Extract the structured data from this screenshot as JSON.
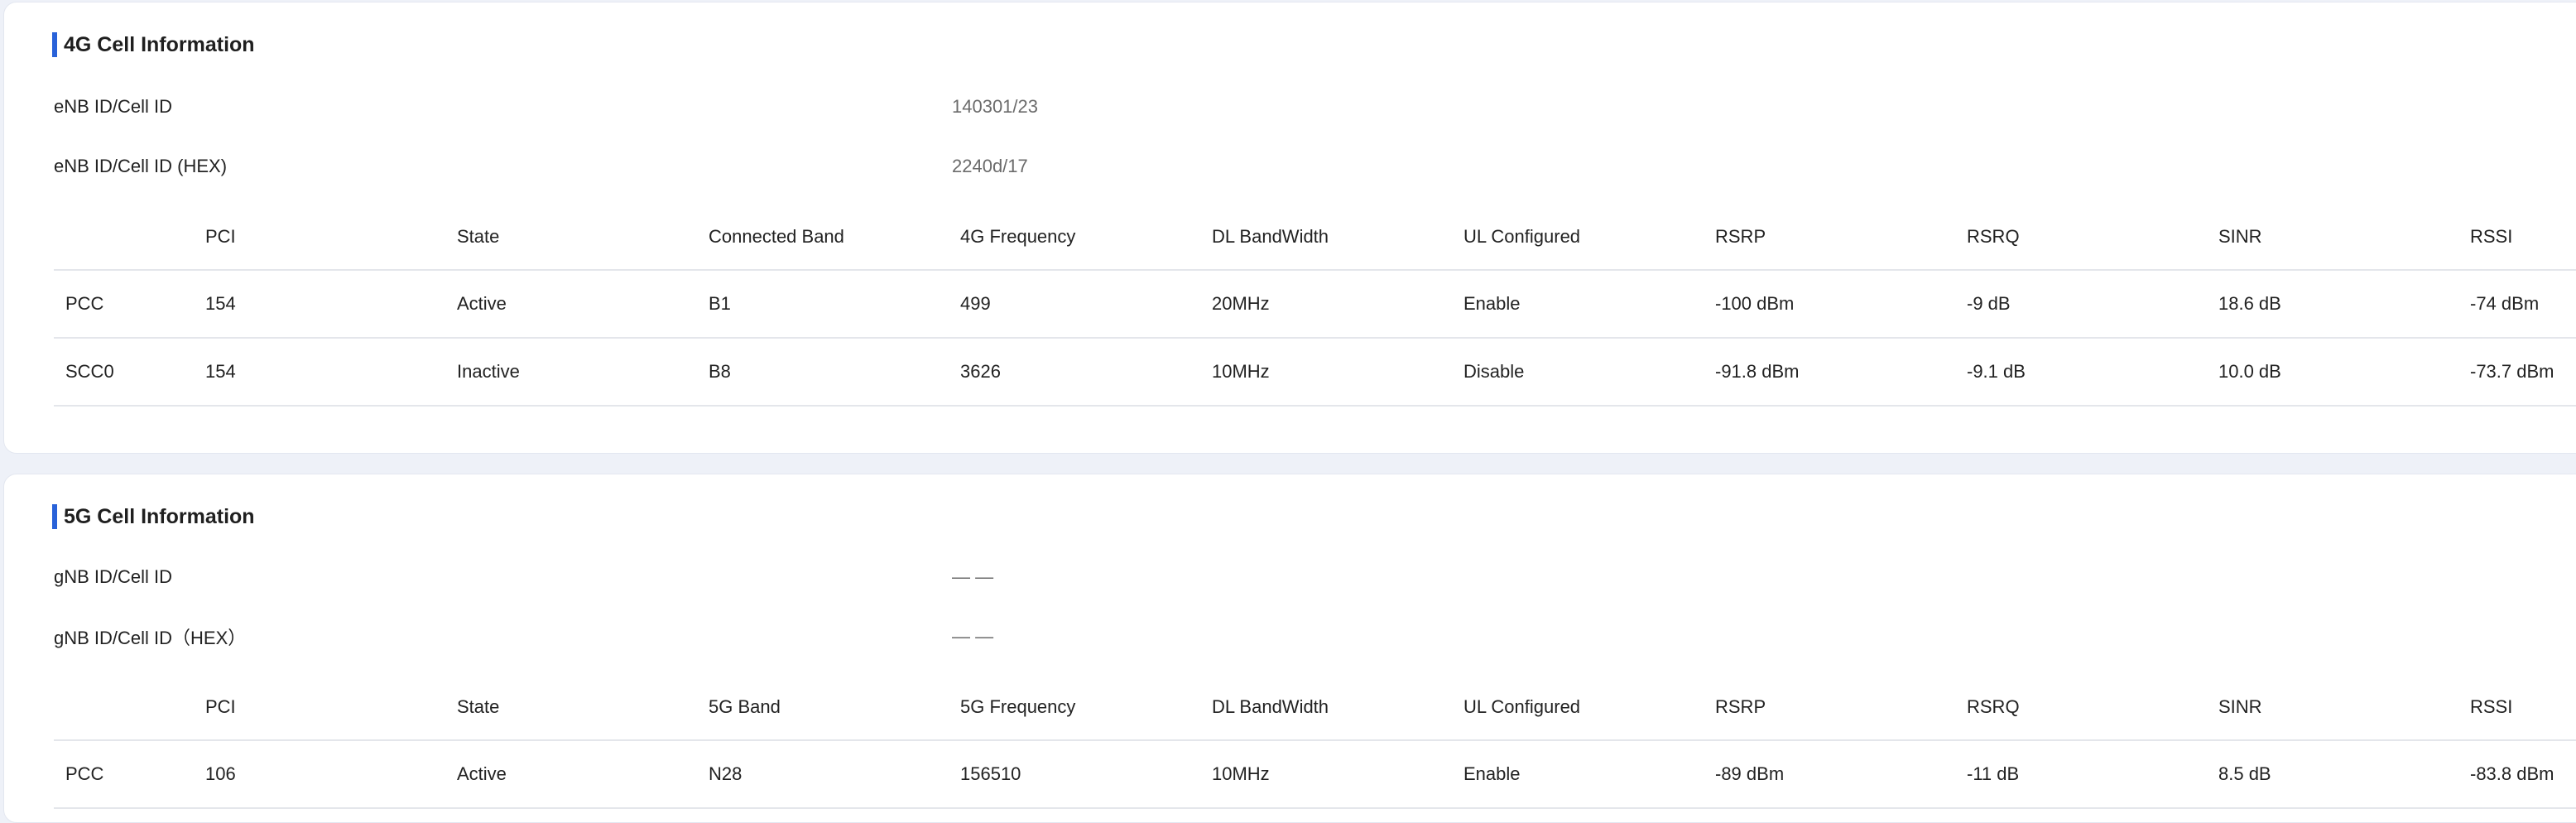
{
  "cell_4g": {
    "title": "4G Cell Information",
    "rows": [
      {
        "label": "eNB ID/Cell ID",
        "value": "140301/23"
      },
      {
        "label": "eNB ID/Cell ID (HEX)",
        "value": "2240d/17"
      }
    ],
    "columns": [
      "",
      "PCI",
      "State",
      "Connected Band",
      "4G Frequency",
      "DL BandWidth",
      "UL Configured",
      "RSRP",
      "RSRQ",
      "SINR",
      "RSSI"
    ],
    "carriers": [
      [
        "PCC",
        "154",
        "Active",
        "B1",
        "499",
        "20MHz",
        "Enable",
        "-100 dBm",
        "-9 dB",
        "18.6 dB",
        "-74 dBm"
      ],
      [
        "SCC0",
        "154",
        "Inactive",
        "B8",
        "3626",
        "10MHz",
        "Disable",
        "-91.8 dBm",
        "-9.1 dB",
        "10.0 dB",
        "-73.7 dBm"
      ]
    ]
  },
  "cell_5g": {
    "title": "5G Cell Information",
    "rows": [
      {
        "label": "gNB ID/Cell ID",
        "value": "— —"
      },
      {
        "label": "gNB ID/Cell ID（HEX）",
        "value": "— —"
      }
    ],
    "columns": [
      "",
      "PCI",
      "State",
      "5G Band",
      "5G Frequency",
      "DL BandWidth",
      "UL Configured",
      "RSRP",
      "RSRQ",
      "SINR",
      "RSSI"
    ],
    "carriers": [
      [
        "PCC",
        "106",
        "Active",
        "N28",
        "156510",
        "10MHz",
        "Enable",
        "-89 dBm",
        "-11 dB",
        "8.5 dB",
        "-83.8 dBm"
      ]
    ]
  },
  "colors": {
    "accent": "#2962d9",
    "background": "#eef1f8",
    "card": "#ffffff",
    "divider": "#e4e6eb"
  }
}
